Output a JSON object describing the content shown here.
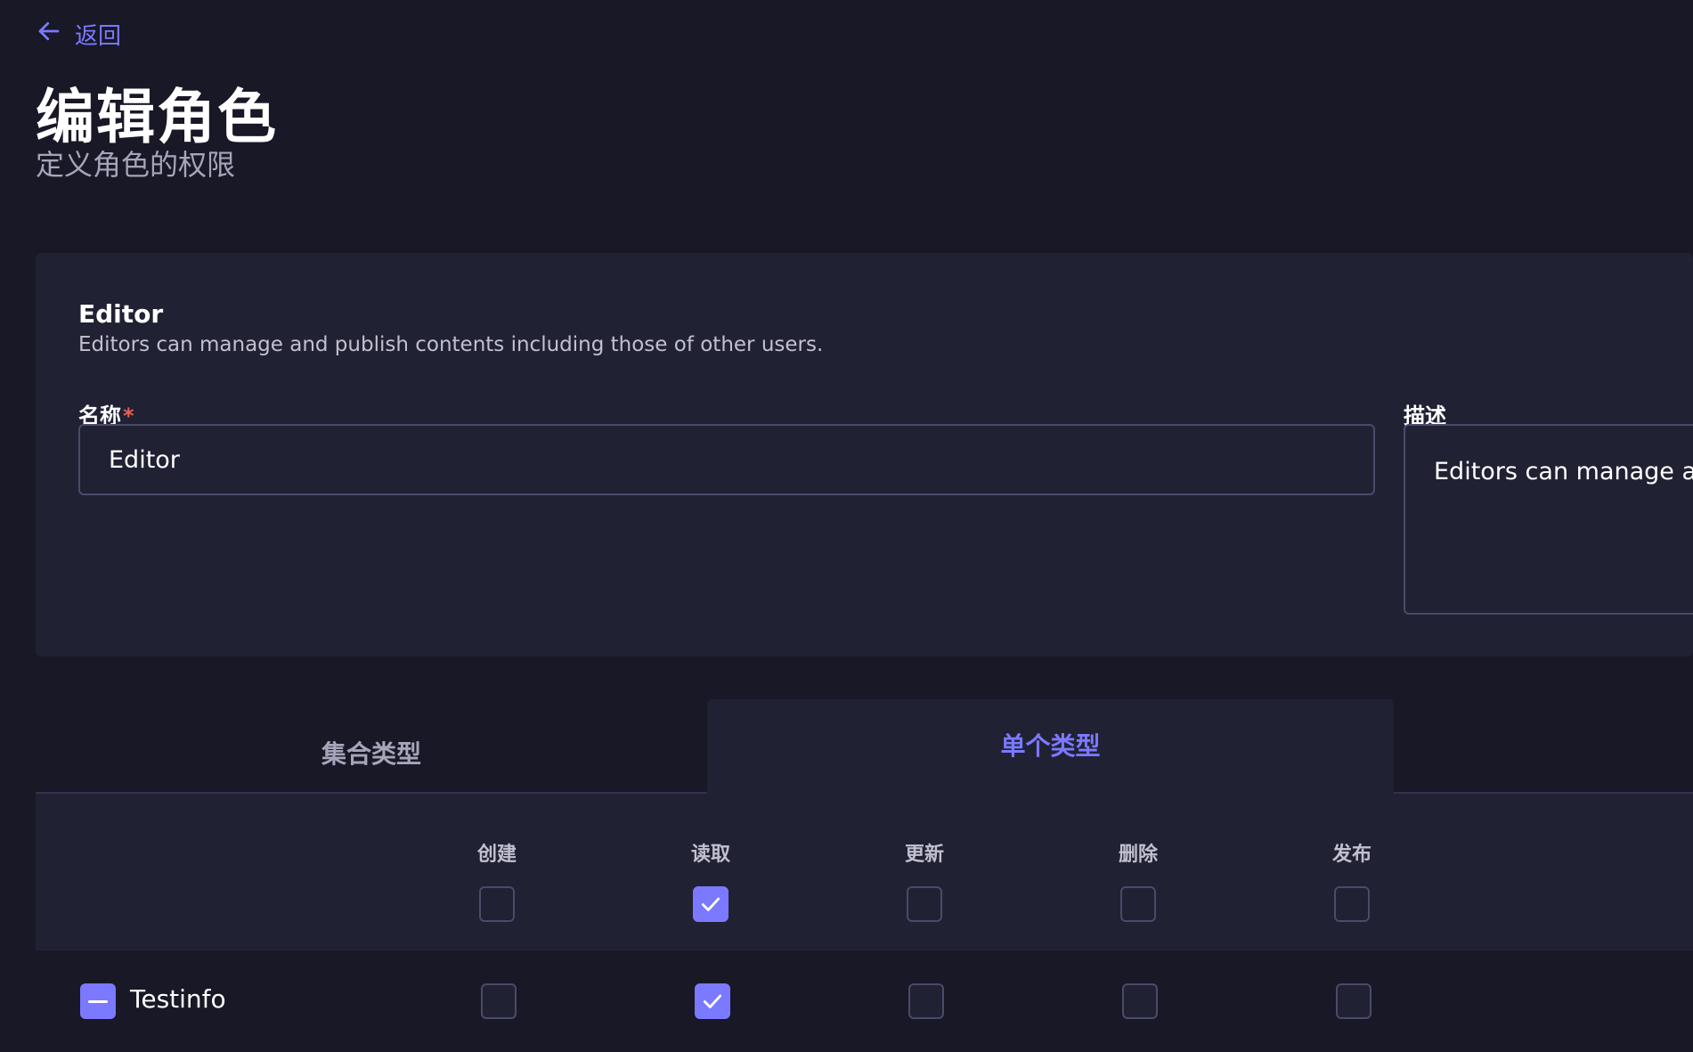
{
  "header": {
    "back_label": "返回",
    "title": "编辑角色",
    "subtitle": "定义角色的权限"
  },
  "role": {
    "name": "Editor",
    "description": "Editors can manage and publish contents including those of other users.",
    "name_label": "名称",
    "name_required_mark": "*",
    "name_value": "Editor",
    "description_label": "描述",
    "description_value": "Editors can manage and publish contents including those of other users."
  },
  "tabs": [
    {
      "label": "集合类型",
      "active": false
    },
    {
      "label": "单个类型",
      "active": true
    }
  ],
  "permission_columns": [
    "创建",
    "读取",
    "更新",
    "删除",
    "发布"
  ],
  "header_checks": [
    false,
    true,
    false,
    false,
    false
  ],
  "rows": [
    {
      "label": "Testinfo",
      "checks": [
        false,
        true,
        false,
        false,
        false
      ]
    }
  ],
  "colors": {
    "accent": "#7b79ff",
    "background": "#181826",
    "panel": "#212134",
    "border": "#4a4a6a",
    "required": "#ee5e52"
  },
  "icons": {
    "back": "arrow-left-icon",
    "check": "check-icon",
    "collapse": "minus-icon"
  }
}
